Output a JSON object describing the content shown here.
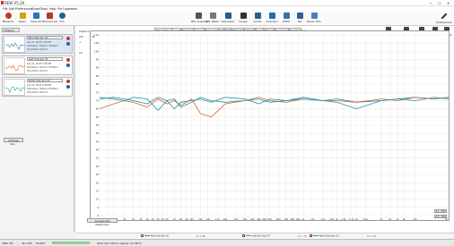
{
  "window": {
    "title": "REW V5.20",
    "min": "—",
    "max": "☐",
    "close": "✕"
  },
  "menu": [
    "File",
    "Edit",
    "Preferences",
    "Graph",
    "Tools",
    "Help",
    "Pro Upgrades"
  ],
  "toolbar_left": [
    {
      "label": "Measure",
      "icon": "measure-icon",
      "color": "#c0392b"
    },
    {
      "label": "Open",
      "icon": "open-folder-icon",
      "color": "#d4a017"
    },
    {
      "label": "Save All",
      "icon": "save-icon",
      "color": "#2c6fbb"
    },
    {
      "label": "Remove All",
      "icon": "remove-all-icon",
      "color": "#b03a2e"
    },
    {
      "label": "Info",
      "icon": "info-icon",
      "color": "#1f5fa8"
    }
  ],
  "toolbar_center": [
    {
      "label": "RTA Analyser",
      "icon": "rta-icon"
    },
    {
      "label": "SPL Meter",
      "icon": "spl-meter-icon"
    },
    {
      "label": "Generator",
      "icon": "generator-icon"
    },
    {
      "label": "Scope",
      "icon": "scope-icon"
    },
    {
      "label": "Limits",
      "icon": "limits-icon"
    },
    {
      "label": "Overlays",
      "icon": "overlays-icon"
    },
    {
      "label": "RT60",
      "icon": "rt60-icon"
    },
    {
      "label": "EQ",
      "icon": "eq-icon"
    },
    {
      "label": "Room Sim",
      "icon": "room-sim-icon"
    }
  ],
  "toolbar_right": {
    "label": "Preferences",
    "icon": "wrench-icon"
  },
  "left_panel": {
    "header": "10Ilyeni",
    "change_cal": "Change Cal...",
    "measurements": [
      {
        "name": "Mid Sub Spr 23",
        "date": "Apr 22, 2023 4:35 PM",
        "device": "Hardware: TASCO 2 MidSpd",
        "file": "Smoothed 1/6 Oct",
        "selected": true,
        "color": "#2f7fa8"
      },
      {
        "name": "Left Sub Spr 27",
        "date": "Apr 22, 2023 4:36 PM",
        "device": "Hardware: TASCO 2 MidSpd",
        "file": "Smoothed 1/6 Oct",
        "selected": false,
        "color": "#d06a2a"
      },
      {
        "name": "Rmid Sub Spr 22",
        "date": "Apr 22, 2023 4:38 PM",
        "device": "Hardware: TASCO 2 MidSpd",
        "file": "Smoothed 1/6 Oct",
        "selected": false,
        "color": "#1f9a9a"
      }
    ]
  },
  "graph": {
    "tabs": [
      "SPL & Phase",
      "All SPL",
      "Distortion",
      "Impulse",
      "Filtered IR",
      "GD",
      "RT60",
      "RT60 Decay",
      "Waterfall",
      "Decay",
      "Filled Vol",
      "Spectrogram",
      "Oscilloscope"
    ],
    "active_tab": 1,
    "left_tools": [
      "Capture",
      "Ctrl",
      "+",
      "-",
      "10-"
    ],
    "right_tools": [
      {
        "label": "Separate",
        "icon": "separate-icon"
      },
      {
        "label": "Controls",
        "icon": "controls-icon"
      },
      {
        "label": "Freq. Axis",
        "icon": "freq-axis-icon"
      },
      {
        "label": "Limits",
        "icon": "limits-icon"
      },
      {
        "label": "Controls",
        "icon": "controls-icon"
      }
    ],
    "average_btn": "Average the Responses",
    "side_buttons": [
      "1X  - 300",
      "0.0  - 300"
    ],
    "y_ticks": [
      "110",
      "105",
      "100",
      "95",
      "90",
      "85",
      "80",
      "75",
      "70",
      "65",
      "60",
      "55",
      "50",
      "45",
      "40",
      "35",
      "30",
      "25",
      "20",
      "15",
      "10",
      "5",
      "0"
    ],
    "x_ticks": [
      "15.0",
      "18",
      "20",
      "25",
      "30",
      "35",
      "40",
      "45",
      "50",
      "55",
      "60",
      "70",
      "80",
      "90",
      "100",
      "120",
      "140",
      "170",
      "200",
      "250",
      "300",
      "350",
      "400",
      "450",
      "500",
      "600",
      "700",
      "800",
      "900",
      "1k",
      "1.2k",
      "1.5k",
      "1.8k",
      "2k",
      "2.3k",
      "2.7k",
      "3k",
      "3.6k",
      "5k",
      "6k",
      "7k",
      "8k",
      "10k"
    ],
    "ylabel": "dB",
    "xlabel": "Hz"
  },
  "chart_data": {
    "type": "line",
    "xlabel": "Hz",
    "ylabel": "dB",
    "ylim": [
      0,
      110
    ],
    "x_scale": "log",
    "xlim": [
      15,
      20000
    ],
    "grid": true,
    "series": [
      {
        "name": "Mid Sub Spr 23",
        "color": "#2f7fa8",
        "x": [
          15,
          20,
          25,
          30,
          40,
          50,
          60,
          70,
          80,
          100,
          120,
          150,
          200,
          300,
          400,
          500,
          700,
          1000,
          1500,
          2000,
          3000,
          5000,
          7000,
          10000,
          15000,
          20000
        ],
        "values": [
          71,
          72,
          71,
          70,
          68,
          72,
          70,
          65,
          69,
          70,
          71,
          69,
          72,
          71,
          68,
          71,
          70,
          72,
          70,
          71,
          69,
          70,
          71,
          72,
          71,
          72
        ]
      },
      {
        "name": "Left Sub Spr 27",
        "color": "#d06a2a",
        "x": [
          15,
          20,
          25,
          30,
          40,
          50,
          60,
          70,
          80,
          100,
          120,
          150,
          200,
          300,
          400,
          500,
          700,
          1000,
          1500,
          2000,
          3000,
          5000,
          7000,
          10000,
          15000,
          20000
        ],
        "values": [
          65,
          68,
          70,
          69,
          66,
          71,
          68,
          70,
          67,
          71,
          62,
          60,
          68,
          70,
          72,
          70,
          69,
          71,
          70,
          70,
          69,
          71,
          70,
          72,
          71,
          72
        ]
      },
      {
        "name": "Rmid Sub Spr 22",
        "color": "#1f9a9a",
        "x": [
          15,
          20,
          25,
          30,
          40,
          50,
          60,
          70,
          80,
          100,
          120,
          150,
          200,
          300,
          400,
          500,
          700,
          1000,
          1500,
          2000,
          3000,
          5000,
          7000,
          10000,
          15000,
          20000
        ],
        "values": [
          72,
          71,
          70,
          72,
          71,
          64,
          70,
          71,
          66,
          69,
          72,
          70,
          69,
          70,
          71,
          69,
          70,
          71,
          70,
          69,
          65,
          70,
          71,
          70,
          72,
          71
        ]
      }
    ]
  },
  "legend": [
    {
      "label": "Mid Sub Spr 23",
      "color": "#2f7fa8",
      "value": "71.1 dB"
    },
    {
      "label": "Left Sub Spr 27",
      "color": "#d06a2a",
      "value": "70.7 dB"
    },
    {
      "label": "Rmid Sub Spr 22",
      "color": "#1f9a9a",
      "value": "70.3 dB"
    }
  ],
  "status": {
    "memory": "460/1 Mb",
    "sample_rate": "44.1 kHz",
    "bits": "Float32",
    "message": "Peak input before clipping: 0.0 dB FS"
  }
}
